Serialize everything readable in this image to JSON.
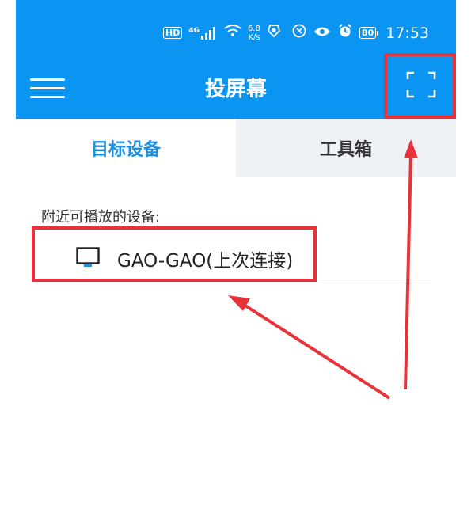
{
  "status_bar": {
    "hd": "HD",
    "network_type": "4G",
    "speed_value": "6.8",
    "speed_unit": "K/s",
    "battery": "80",
    "time": "17:53"
  },
  "app_bar": {
    "title": "投屏幕"
  },
  "tabs": [
    {
      "label": "目标设备",
      "active": true
    },
    {
      "label": "工具箱",
      "active": false
    }
  ],
  "devices_section": {
    "label": "附近可播放的设备:",
    "devices": [
      {
        "name": "GAO-GAO(上次连接)"
      }
    ]
  },
  "colors": {
    "primary": "#0b95f2",
    "tab_active_text": "#1a8fe3",
    "annotation_red": "#e8323a"
  }
}
